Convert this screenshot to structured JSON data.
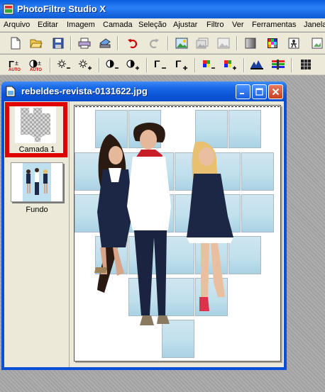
{
  "app": {
    "title": "PhotoFiltre Studio X"
  },
  "menu": {
    "items": [
      "Arquivo",
      "Editar",
      "Imagem",
      "Camada",
      "Seleção",
      "Ajustar",
      "Filtro",
      "Ver",
      "Ferramentas",
      "Janela"
    ]
  },
  "toolbar1": {
    "icons": [
      "new-icon",
      "open-icon",
      "save-icon",
      "print-icon",
      "scan-icon",
      "undo-icon",
      "redo-icon",
      "image-browser-icon",
      "image-stack-icon",
      "image-copy-icon",
      "gradient-icon",
      "palette-icon",
      "person-icon",
      "image-export-icon"
    ]
  },
  "toolbar2": {
    "gamma_text": "AUTO",
    "icons": [
      "gamma-plus-icon",
      "contrast-auto-icon",
      "brightness-minus-icon",
      "brightness-plus-icon",
      "contrast-minus-icon",
      "contrast-plus-icon",
      "gamma-minus-icon",
      "gamma-plus2-icon",
      "saturation-minus-icon",
      "saturation-plus-icon",
      "levels-icon",
      "color-balance-icon",
      "grid-icon"
    ]
  },
  "document": {
    "title": "rebeldes-revista-0131622.jpg",
    "layers": [
      {
        "label": "Camada 1"
      },
      {
        "label": "Fundo"
      }
    ]
  },
  "colors": {
    "title_blue": "#0a5ee0",
    "highlight_red": "#e00000",
    "window_bg": "#ece9d8"
  }
}
